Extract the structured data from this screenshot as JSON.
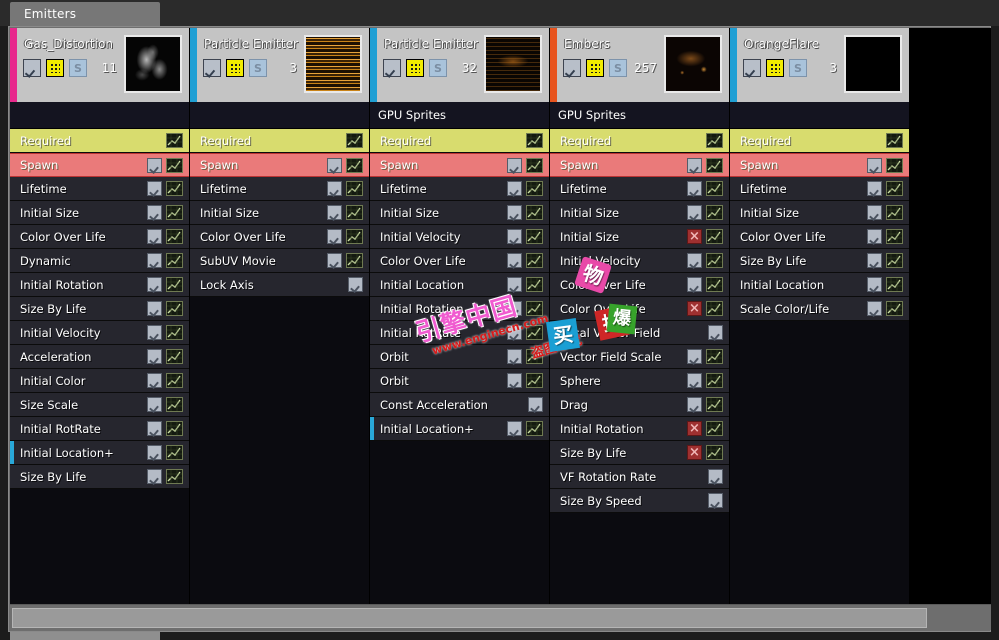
{
  "window": {
    "tab_label": "Emitters"
  },
  "colors": {
    "required_row": "#d8dc6e",
    "spawn_row": "#ea7a7a",
    "module_row": "#26262e",
    "selection": "#29a8d8",
    "enabled_check": "#b4bbc6",
    "disabled_check": "#9e3030"
  },
  "scrollbar": {
    "orientation": "horizontal"
  },
  "emitters": [
    {
      "name": "Gas_Distortion",
      "strip_color": "#e8288c",
      "count": "11",
      "type_label": "",
      "thumb": "th-gas",
      "enabled": true,
      "view_icon": "render-icon",
      "solo_label": "S",
      "modules": [
        {
          "label": "Required",
          "style": "required",
          "check": null,
          "curve": true
        },
        {
          "label": "Spawn",
          "style": "spawn",
          "check": "on",
          "curve": true
        },
        {
          "label": "Lifetime",
          "style": "",
          "check": "on",
          "curve": true
        },
        {
          "label": "Initial Size",
          "style": "",
          "check": "on",
          "curve": true
        },
        {
          "label": "Color Over Life",
          "style": "",
          "check": "on",
          "curve": true
        },
        {
          "label": "Dynamic",
          "style": "",
          "check": "on",
          "curve": true
        },
        {
          "label": "Initial Rotation",
          "style": "",
          "check": "on",
          "curve": true
        },
        {
          "label": "Size By Life",
          "style": "",
          "check": "on",
          "curve": true
        },
        {
          "label": "Initial Velocity",
          "style": "",
          "check": "on",
          "curve": true
        },
        {
          "label": "Acceleration",
          "style": "",
          "check": "on",
          "curve": true
        },
        {
          "label": "Initial Color",
          "style": "",
          "check": "on",
          "curve": true
        },
        {
          "label": "Size Scale",
          "style": "",
          "check": "on",
          "curve": true
        },
        {
          "label": "Initial RotRate",
          "style": "",
          "check": "on",
          "curve": true
        },
        {
          "label": "Initial Location+",
          "style": "selected",
          "check": "on",
          "curve": true
        },
        {
          "label": "Size By Life",
          "style": "",
          "check": "on",
          "curve": true
        }
      ]
    },
    {
      "name": "Particle Emitter",
      "strip_color": "#1f9fd4",
      "count": "3",
      "type_label": "",
      "thumb": "th-pe1",
      "enabled": true,
      "view_icon": "render-icon",
      "solo_label": "S",
      "modules": [
        {
          "label": "Required",
          "style": "required",
          "check": null,
          "curve": true
        },
        {
          "label": "Spawn",
          "style": "spawn",
          "check": "on",
          "curve": true
        },
        {
          "label": "Lifetime",
          "style": "",
          "check": "on",
          "curve": true
        },
        {
          "label": "Initial Size",
          "style": "",
          "check": "on",
          "curve": true
        },
        {
          "label": "Color Over Life",
          "style": "",
          "check": "on",
          "curve": true
        },
        {
          "label": "SubUV Movie",
          "style": "",
          "check": "on",
          "curve": true
        },
        {
          "label": "Lock Axis",
          "style": "",
          "check": "on",
          "curve": false
        }
      ]
    },
    {
      "name": "Particle Emitter",
      "strip_color": "#1f9fd4",
      "count": "32",
      "type_label": "GPU Sprites",
      "thumb": "th-pe2",
      "enabled": true,
      "view_icon": "render-icon",
      "solo_label": "S",
      "modules": [
        {
          "label": "Required",
          "style": "required",
          "check": null,
          "curve": true
        },
        {
          "label": "Spawn",
          "style": "spawn",
          "check": "on",
          "curve": true
        },
        {
          "label": "Lifetime",
          "style": "",
          "check": "on",
          "curve": true
        },
        {
          "label": "Initial Size",
          "style": "",
          "check": "on",
          "curve": true
        },
        {
          "label": "Initial Velocity",
          "style": "",
          "check": "on",
          "curve": true
        },
        {
          "label": "Color Over Life",
          "style": "",
          "check": "on",
          "curve": true
        },
        {
          "label": "Initial Location",
          "style": "",
          "check": "on",
          "curve": true
        },
        {
          "label": "Initial Rotation",
          "style": "",
          "check": "on",
          "curve": true
        },
        {
          "label": "Initial RotRate",
          "style": "",
          "check": "on",
          "curve": true
        },
        {
          "label": "Orbit",
          "style": "",
          "check": "on",
          "curve": true
        },
        {
          "label": "Orbit",
          "style": "",
          "check": "on",
          "curve": true
        },
        {
          "label": "Const Acceleration",
          "style": "",
          "check": "on",
          "curve": false
        },
        {
          "label": "Initial Location+",
          "style": "selected",
          "check": "on",
          "curve": true
        }
      ]
    },
    {
      "name": "Embers",
      "strip_color": "#e8541e",
      "count": "257",
      "type_label": "GPU Sprites",
      "thumb": "th-emb",
      "enabled": true,
      "view_icon": "render-icon",
      "solo_label": "S",
      "modules": [
        {
          "label": "Required",
          "style": "required",
          "check": null,
          "curve": true
        },
        {
          "label": "Spawn",
          "style": "spawn",
          "check": "on",
          "curve": true
        },
        {
          "label": "Lifetime",
          "style": "",
          "check": "on",
          "curve": true
        },
        {
          "label": "Initial Size",
          "style": "",
          "check": "on",
          "curve": true
        },
        {
          "label": "Initial Size",
          "style": "",
          "check": "off",
          "curve": true
        },
        {
          "label": "Initial Velocity",
          "style": "",
          "check": "on",
          "curve": true
        },
        {
          "label": "Color Over Life",
          "style": "",
          "check": "on",
          "curve": true
        },
        {
          "label": "Color Over Life",
          "style": "",
          "check": "off",
          "curve": true
        },
        {
          "label": "Local Vector Field",
          "style": "",
          "check": "on",
          "curve": false
        },
        {
          "label": "Vector Field Scale",
          "style": "",
          "check": "on",
          "curve": true
        },
        {
          "label": "Sphere",
          "style": "",
          "check": "on",
          "curve": true
        },
        {
          "label": "Drag",
          "style": "",
          "check": "on",
          "curve": true
        },
        {
          "label": "Initial Rotation",
          "style": "",
          "check": "off",
          "curve": true
        },
        {
          "label": "Size By Life",
          "style": "",
          "check": "off",
          "curve": true
        },
        {
          "label": "VF Rotation Rate",
          "style": "",
          "check": "on",
          "curve": false
        },
        {
          "label": "Size By Speed",
          "style": "",
          "check": "on",
          "curve": false
        }
      ]
    },
    {
      "name": "OrangeFlare",
      "strip_color": "#1f9fd4",
      "count": "3",
      "type_label": "",
      "thumb": "th-blank",
      "enabled": true,
      "view_icon": "render-icon",
      "solo_label": "S",
      "modules": [
        {
          "label": "Required",
          "style": "required",
          "check": null,
          "curve": true
        },
        {
          "label": "Spawn",
          "style": "spawn",
          "check": "on",
          "curve": true
        },
        {
          "label": "Lifetime",
          "style": "",
          "check": "on",
          "curve": true
        },
        {
          "label": "Initial Size",
          "style": "",
          "check": "on",
          "curve": true
        },
        {
          "label": "Color Over Life",
          "style": "",
          "check": "on",
          "curve": true
        },
        {
          "label": "Size By Life",
          "style": "",
          "check": "on",
          "curve": true
        },
        {
          "label": "Initial Location",
          "style": "",
          "check": "on",
          "curve": true
        },
        {
          "label": "Scale Color/Life",
          "style": "",
          "check": "on",
          "curve": true
        }
      ]
    }
  ],
  "watermark": {
    "main": "引擎中国",
    "url": "www.enginecn.com",
    "note": "盗图必究",
    "stamps": [
      "买",
      "物",
      "拍",
      "爆"
    ]
  }
}
